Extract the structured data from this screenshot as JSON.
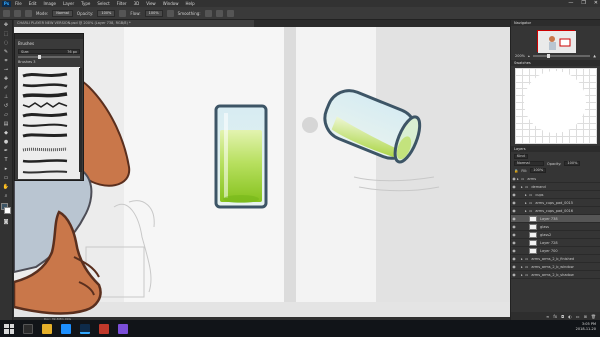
{
  "app": {
    "logo": "Ps",
    "window_controls": [
      "—",
      "❐",
      "✕"
    ]
  },
  "menu": [
    "File",
    "Edit",
    "Image",
    "Layer",
    "Type",
    "Select",
    "Filter",
    "3D",
    "View",
    "Window",
    "Help"
  ],
  "options_bar": {
    "mode_label": "Mode:",
    "mode_value": "Normal",
    "opacity_label": "Opacity:",
    "opacity_value": "100%",
    "flow_label": "Flow:",
    "flow_value": "100%",
    "smoothing_label": "Smoothing:"
  },
  "document": {
    "tab_title": "CHARLI PLAYER NEW VERSION.psd @ 200% (Layer 738, RGB/8) *",
    "status": "Doc: 39.3M/1.09G"
  },
  "brush_panel": {
    "title": "Brushes",
    "size_label": "Size:",
    "size_value": "76 px",
    "group_name": "Brushes 3"
  },
  "navigator": {
    "tab": "Navigator",
    "zoom": "200%"
  },
  "swatches": {
    "tab": "Swatches"
  },
  "layers": {
    "tab": "Layers",
    "kind_label": "Kind",
    "blend_mode": "Normal",
    "opacity_label": "Opacity:",
    "opacity_value": "100%",
    "fill_label": "Fill:",
    "fill_value": "100%",
    "items": [
      {
        "name": "arms",
        "indent": 0,
        "folder": true,
        "selected": false
      },
      {
        "name": "demand",
        "indent": 1,
        "folder": true,
        "selected": false
      },
      {
        "name": "cups",
        "indent": 2,
        "folder": true,
        "selected": false
      },
      {
        "name": "arms_cups_pad_0015",
        "indent": 2,
        "folder": true,
        "selected": false
      },
      {
        "name": "arms_cups_pad_0016",
        "indent": 2,
        "folder": true,
        "selected": false
      },
      {
        "name": "Layer 738",
        "indent": 3,
        "folder": false,
        "selected": true
      },
      {
        "name": "glass",
        "indent": 3,
        "folder": false,
        "selected": false
      },
      {
        "name": "glass2",
        "indent": 3,
        "folder": false,
        "selected": false
      },
      {
        "name": "Layer 728",
        "indent": 3,
        "folder": false,
        "selected": false
      },
      {
        "name": "Layer 700",
        "indent": 3,
        "folder": false,
        "selected": false
      },
      {
        "name": "arms_arms_2_b_finished",
        "indent": 1,
        "folder": true,
        "selected": false
      },
      {
        "name": "arms_arms_2_b_window",
        "indent": 1,
        "folder": true,
        "selected": false
      },
      {
        "name": "arms_arms_2_b_shadow",
        "indent": 1,
        "folder": true,
        "selected": false
      }
    ]
  },
  "taskbar": {
    "time": "3:05 PM",
    "date": "2018-11-20"
  },
  "colors": {
    "glass_outline": "#3d5566",
    "liquid": "#9ad43a",
    "canvas_bg": "#eeeeee",
    "skin": "#c9774a",
    "ui_dark": "#323232"
  }
}
